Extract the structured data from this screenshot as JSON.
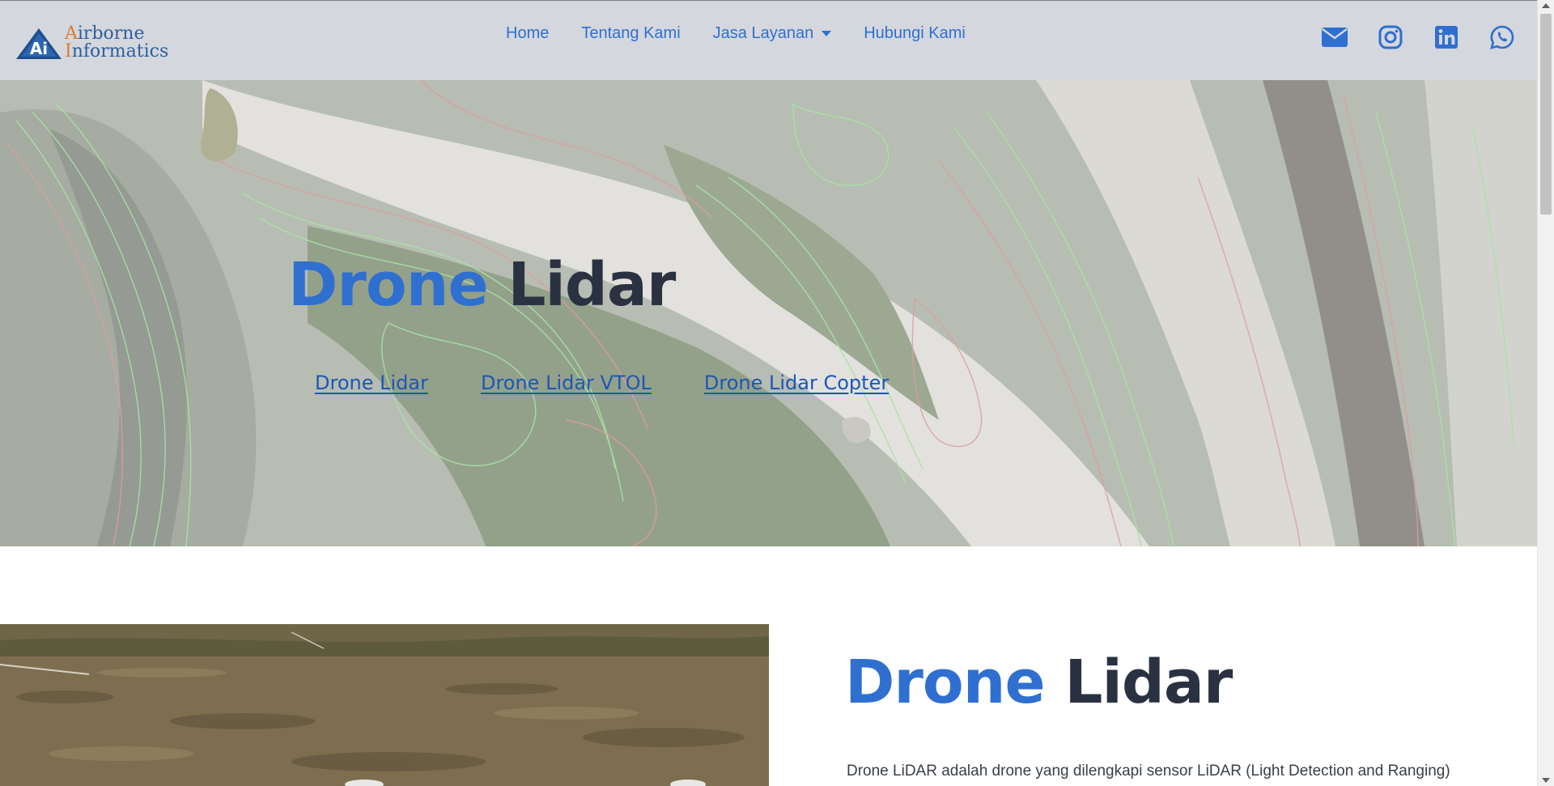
{
  "logo": {
    "line1": "Airborne",
    "line2": "Informatics",
    "mark": "Ai"
  },
  "nav": {
    "items": [
      "Home",
      "Tentang Kami",
      "Jasa Layanan",
      "Hubungi Kami"
    ],
    "dropdown_icon": "caret-down-icon"
  },
  "social": {
    "icons": [
      "envelope-icon",
      "instagram-icon",
      "linkedin-icon",
      "whatsapp-icon"
    ],
    "color": "#2f6fd0"
  },
  "hero": {
    "title_word1": "Drone",
    "title_word2": "Lidar",
    "links": [
      "Drone Lidar",
      "Drone Lidar VTOL",
      "Drone Lidar Copter"
    ]
  },
  "section": {
    "title_word1": "Drone",
    "title_word2": "Lidar",
    "text": "Drone LiDAR adalah drone yang dilengkapi sensor LiDAR (Light Detection and Ranging)"
  },
  "colors": {
    "accent": "#2f6fd0",
    "dark": "#2a3242",
    "header_bg": "#d4d7dd"
  }
}
